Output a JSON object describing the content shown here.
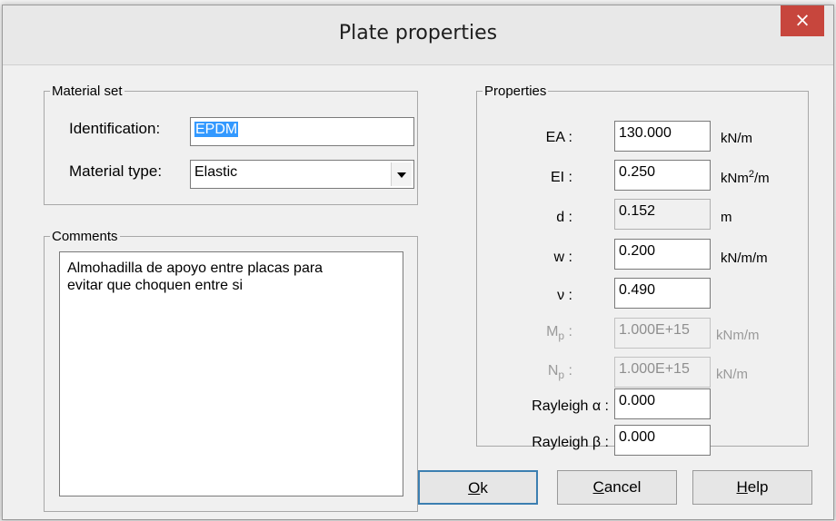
{
  "window": {
    "title": "Plate properties",
    "close_glyph": "×"
  },
  "material_set": {
    "legend": "Material set",
    "identification_label": "Identification:",
    "identification_value": "EPDM",
    "material_type_label": "Material type:",
    "material_type_value": "Elastic"
  },
  "comments": {
    "legend": "Comments",
    "text_line1": "Almohadilla de apoyo entre placas para",
    "text_line2": "evitar que choquen entre si"
  },
  "properties": {
    "legend": "Properties",
    "EA": {
      "label": "EA :",
      "value": "130.000",
      "unit": "kN/m"
    },
    "EI": {
      "label": "EI :",
      "value": "0.250",
      "unit_base": "kNm",
      "unit_sup": "2",
      "unit_tail": "/m"
    },
    "d": {
      "label": "d :",
      "value": "0.152",
      "unit": "m"
    },
    "w": {
      "label": "w :",
      "value": "0.200",
      "unit": "kN/m/m"
    },
    "nu": {
      "label": "ν :",
      "value": "0.490"
    },
    "Mp": {
      "label_main": "M",
      "label_sub": "p",
      "label_colon": " :",
      "value": "1.000E+15",
      "unit": "kNm/m"
    },
    "Np": {
      "label_main": "N",
      "label_sub": "p",
      "label_colon": " :",
      "value": "1.000E+15",
      "unit": "kN/m"
    },
    "rayleigh_alpha": {
      "label": "Rayleigh α :",
      "value": "0.000"
    },
    "rayleigh_beta": {
      "label": "Rayleigh β :",
      "value": "0.000"
    }
  },
  "buttons": {
    "ok_mnemonic": "O",
    "ok_rest": "k",
    "cancel_mnemonic": "C",
    "cancel_rest": "ancel",
    "help_mnemonic": "H",
    "help_rest": "elp"
  },
  "colors": {
    "close_button": "#c7463d",
    "selection": "#3399ff",
    "default_button_border": "#3c7fb1"
  }
}
